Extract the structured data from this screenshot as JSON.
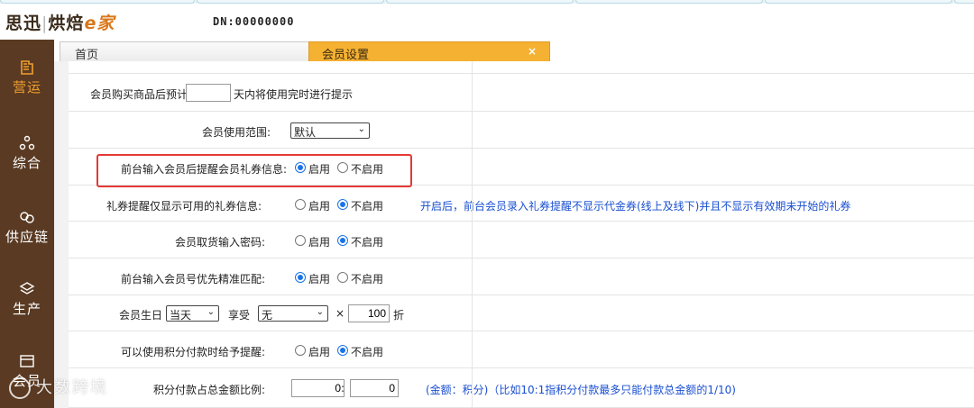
{
  "app": {
    "logo_brand": "思迅",
    "logo_product": "烘焙",
    "logo_e": "e家",
    "dn": "DN:00000000"
  },
  "sidebar": {
    "items": [
      {
        "label": "营运",
        "icon": "store-icon",
        "active": true
      },
      {
        "label": "综合",
        "icon": "network-icon",
        "active": false
      },
      {
        "label": "供应链",
        "icon": "link-icon",
        "active": false
      },
      {
        "label": "生产",
        "icon": "layers-icon",
        "active": false
      },
      {
        "label": "会员",
        "icon": "card-icon",
        "active": false
      }
    ]
  },
  "tabs": {
    "home": "首页",
    "member": "会员设置",
    "close": "×"
  },
  "form": {
    "precheck": {
      "label": "会员购买商品后预计",
      "value": "",
      "suffix": "天内将使用完时进行提示"
    },
    "scope": {
      "label": "会员使用范围:",
      "selected": "默认"
    },
    "remind_gift": {
      "label": "前台输入会员后提醒会员礼券信息:",
      "on": "启用",
      "off": "不启用",
      "selected": "on"
    },
    "gift_only_available": {
      "label": "礼券提醒仅显示可用的礼券信息:",
      "on": "启用",
      "off": "不启用",
      "selected": "off",
      "note": "开启后，前台会员录入礼券提醒不显示代金券(线上及线下)并且不显示有效期未开始的礼券"
    },
    "pickup_password": {
      "label": "会员取货输入密码:",
      "on": "启用",
      "off": "不启用",
      "selected": "off"
    },
    "exact_match": {
      "label": "前台输入会员号优先精准匹配:",
      "on": "启用",
      "off": "不启用",
      "selected": "on"
    },
    "birthday": {
      "label": "会员生日",
      "day_selected": "当天",
      "enjoy": "享受",
      "discount_selected": "无",
      "times": "×",
      "rate": "100",
      "unit": "折"
    },
    "points_pay_prompt": {
      "label": "可以使用积分付款时给予提醒:",
      "on": "启用",
      "off": "不启用",
      "selected": "off"
    },
    "points_ratio": {
      "label": "积分付款占总金额比例:",
      "left": "0",
      "colon": ":",
      "right": "0",
      "note": "(金额：积分)（比如10:1指积分付款最多只能付款总金额的1/10)"
    }
  },
  "watermark": "大数跨境",
  "colors": {
    "sidebar": "#5a3a22",
    "active_tab": "#f5b132",
    "accent": "#f0a030",
    "radio": "#1a73e8",
    "note": "#1a4fd0",
    "highlight": "#e53935"
  }
}
